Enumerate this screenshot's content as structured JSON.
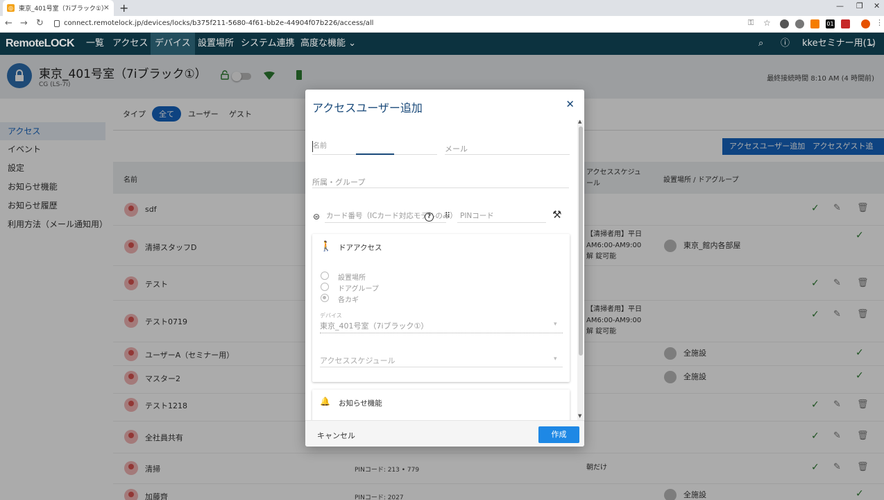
{
  "browser": {
    "tab_title": "東京_401号室（7iブラック①）",
    "url": "connect.remotelock.jp/devices/locks/b375f211-5680-4f61-bb2e-44904f07b226/access/all",
    "ext_01": "01"
  },
  "nav": {
    "logo": "RemoteLOCK",
    "items": [
      "一覧",
      "アクセス",
      "デバイス",
      "設置場所",
      "システム連携",
      "高度な機能"
    ],
    "user": "kkeセミナー用(1)",
    "dropdown_arrow": "⌄"
  },
  "device": {
    "title": "東京_401号室（7iブラック①）",
    "subtitle": "CG (LS-7i)",
    "last_connected": "最終接続時間 8:10 AM (4 時間前)"
  },
  "sidebar": {
    "items": [
      "アクセス",
      "イベント",
      "設定",
      "お知らせ機能",
      "お知らせ履歴",
      "利用方法（メール通知用）"
    ]
  },
  "filters": {
    "type_label": "タイプ",
    "all": "全て",
    "user": "ユーザー",
    "guest": "ゲスト"
  },
  "actions": {
    "add_user": "アクセスユーザー追加",
    "add_guest": "アクセスゲスト追加"
  },
  "table": {
    "headers": {
      "name": "名前",
      "schedule": "アクセススケジュール",
      "location": "設置場所 / ドアグループ"
    },
    "rows": [
      {
        "name": "sdf",
        "pin": "",
        "schedule": "",
        "location": ""
      },
      {
        "name": "清掃スタッフD",
        "pin": "",
        "schedule": "【清掃者用】平日 AM6:00-AM9:00解 錠可能",
        "location": "東京_館内各部屋"
      },
      {
        "name": "テスト",
        "pin": "",
        "schedule": "",
        "location": ""
      },
      {
        "name": "テスト0719",
        "pin": "",
        "schedule": "【清掃者用】平日 AM6:00-AM9:00解 錠可能",
        "location": ""
      },
      {
        "name": "ユーザーA（セミナー用）",
        "pin": "",
        "schedule": "",
        "location": "全施設"
      },
      {
        "name": "マスター2",
        "pin": "",
        "schedule": "",
        "location": "全施設"
      },
      {
        "name": "テスト1218",
        "pin": "",
        "schedule": "",
        "location": ""
      },
      {
        "name": "全社員共有",
        "pin": "",
        "schedule": "",
        "location": ""
      },
      {
        "name": "清掃",
        "pin": "PINコード: 213 • 779",
        "schedule": "朝だけ",
        "location": ""
      },
      {
        "name": "加藤齊",
        "pin": "PINコード: 2027",
        "schedule": "",
        "location": "全施設"
      }
    ]
  },
  "modal": {
    "title": "アクセスユーザー追加",
    "name_label": "名前",
    "email_label": "メール",
    "department_label": "所属・グループ",
    "card_label": "カード番号（ICカード対応モデルのみ）",
    "pin_label": "PINコード",
    "door_access": {
      "title": "ドアアクセス",
      "options": [
        "設置場所",
        "ドアグループ",
        "各カギ"
      ],
      "device_label": "デバイス",
      "device_value": "東京_401号室（7iブラック①）",
      "schedule_placeholder": "アクセススケジュール"
    },
    "notification_title": "お知らせ機能",
    "cancel": "キャンセル",
    "create": "作成"
  }
}
